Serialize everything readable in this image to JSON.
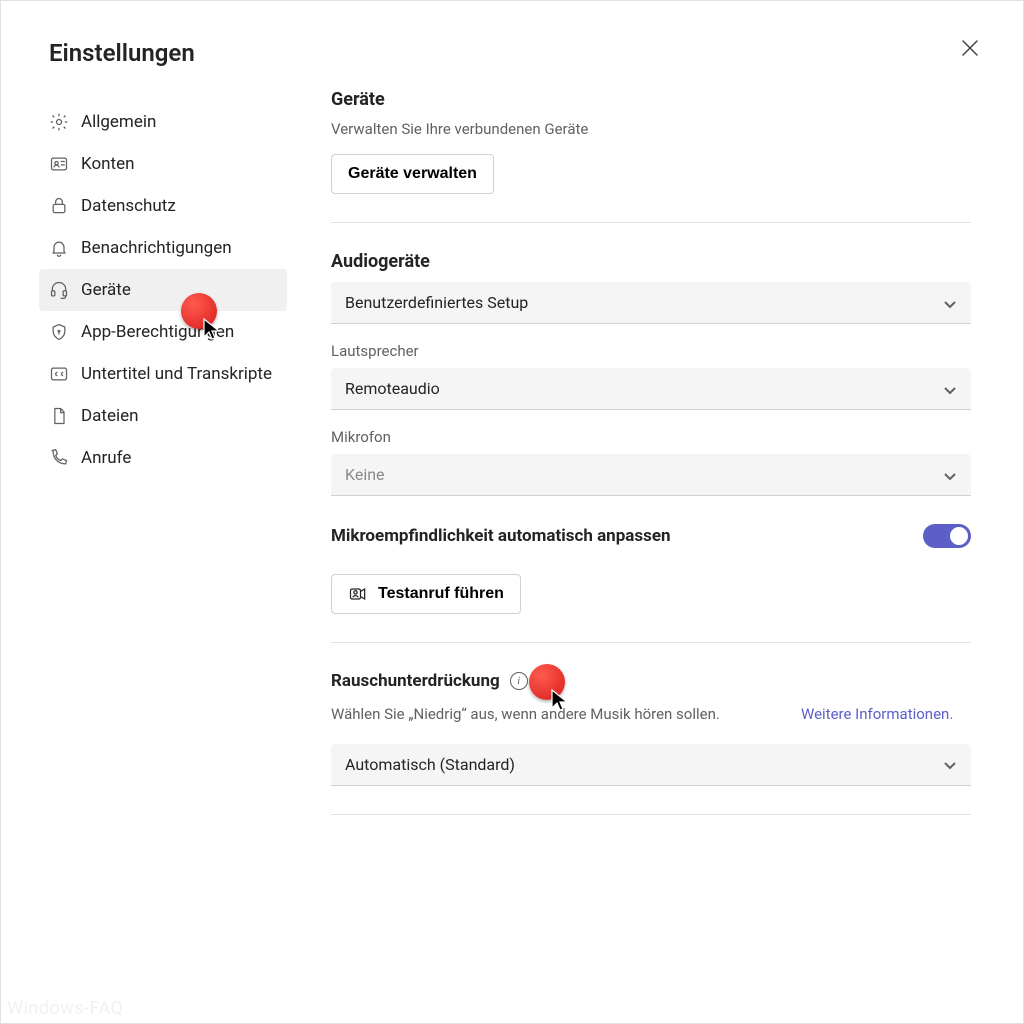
{
  "header": {
    "title": "Einstellungen"
  },
  "sidebar": {
    "items": [
      {
        "label": "Allgemein"
      },
      {
        "label": "Konten"
      },
      {
        "label": "Datenschutz"
      },
      {
        "label": "Benachrichtigungen"
      },
      {
        "label": "Geräte"
      },
      {
        "label": "App-Berechtigungen"
      },
      {
        "label": "Untertitel und Transkripte"
      },
      {
        "label": "Dateien"
      },
      {
        "label": "Anrufe"
      }
    ]
  },
  "devices": {
    "title": "Geräte",
    "subtitle": "Verwalten Sie Ihre verbundenen Geräte",
    "manage_button": "Geräte verwalten"
  },
  "audio": {
    "title": "Audiogeräte",
    "setup_value": "Benutzerdefiniertes Setup",
    "speaker_label": "Lautsprecher",
    "speaker_value": "Remoteaudio",
    "mic_label": "Mikrofon",
    "mic_value": "Keine",
    "auto_sensitivity_label": "Mikroempfindlichkeit automatisch anpassen",
    "test_call_button": "Testanruf führen"
  },
  "noise": {
    "title": "Rauschunterdrückung",
    "description": "Wählen Sie „Niedrig“ aus, wenn andere Musik hören sollen.",
    "link": "Weitere Informationen.",
    "select_value": "Automatisch (Standard)"
  },
  "watermark": "Windows-FAQ"
}
